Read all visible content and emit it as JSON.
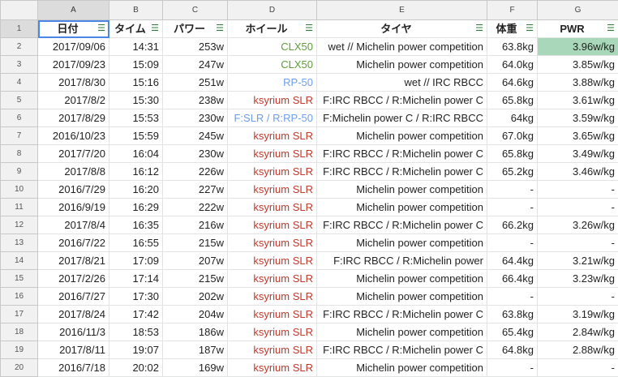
{
  "columns": [
    "A",
    "B",
    "C",
    "D",
    "E",
    "F",
    "G"
  ],
  "header": [
    "日付",
    "タイム",
    "パワー",
    "ホイール",
    "タイヤ",
    "体重",
    "PWR"
  ],
  "rows": [
    {
      "n": "2",
      "date": "2017/09/06",
      "time": "14:31",
      "power": "253w",
      "wheel": "CLX50",
      "wheel_color": "green",
      "tire": "wet // Michelin power competition",
      "weight": "63.8kg",
      "pwr": "3.96w/kg",
      "hl": true
    },
    {
      "n": "3",
      "date": "2017/09/23",
      "time": "15:09",
      "power": "247w",
      "wheel": "CLX50",
      "wheel_color": "green",
      "tire": "Michelin power competition",
      "weight": "64.0kg",
      "pwr": "3.85w/kg"
    },
    {
      "n": "4",
      "date": "2017/8/30",
      "time": "15:16",
      "power": "251w",
      "wheel": "RP-50",
      "wheel_color": "blue",
      "tire": "wet // IRC RBCC",
      "weight": "64.6kg",
      "pwr": "3.88w/kg"
    },
    {
      "n": "5",
      "date": "2017/8/2",
      "time": "15:30",
      "power": "238w",
      "wheel": "ksyrium SLR",
      "wheel_color": "red",
      "tire": "F:IRC RBCC / R:Michelin power C",
      "weight": "65.8kg",
      "pwr": "3.61w/kg"
    },
    {
      "n": "6",
      "date": "2017/8/29",
      "time": "15:53",
      "power": "230w",
      "wheel": "F:SLR / R:RP-50",
      "wheel_color": "blue",
      "tire": "F:Michelin power C / R:IRC RBCC",
      "weight": "64kg",
      "pwr": "3.59w/kg"
    },
    {
      "n": "7",
      "date": "2016/10/23",
      "time": "15:59",
      "power": "245w",
      "wheel": "ksyrium SLR",
      "wheel_color": "red",
      "tire": "Michelin power competition",
      "weight": "67.0kg",
      "pwr": "3.65w/kg"
    },
    {
      "n": "8",
      "date": "2017/7/20",
      "time": "16:04",
      "power": "230w",
      "wheel": "ksyrium SLR",
      "wheel_color": "red",
      "tire": "F:IRC RBCC / R:Michelin power C",
      "weight": "65.8kg",
      "pwr": "3.49w/kg"
    },
    {
      "n": "9",
      "date": "2017/8/8",
      "time": "16:12",
      "power": "226w",
      "wheel": "ksyrium SLR",
      "wheel_color": "red",
      "tire": "F:IRC RBCC / R:Michelin power C",
      "weight": "65.2kg",
      "pwr": "3.46w/kg"
    },
    {
      "n": "10",
      "date": "2016/7/29",
      "time": "16:20",
      "power": "227w",
      "wheel": "ksyrium SLR",
      "wheel_color": "red",
      "tire": "Michelin power competition",
      "weight": "-",
      "pwr": "-"
    },
    {
      "n": "11",
      "date": "2016/9/19",
      "time": "16:29",
      "power": "222w",
      "wheel": "ksyrium SLR",
      "wheel_color": "red",
      "tire": "Michelin power competition",
      "weight": "-",
      "pwr": "-"
    },
    {
      "n": "12",
      "date": "2017/8/4",
      "time": "16:35",
      "power": "216w",
      "wheel": "ksyrium SLR",
      "wheel_color": "red",
      "tire": "F:IRC RBCC / R:Michelin power C",
      "weight": "66.2kg",
      "pwr": "3.26w/kg"
    },
    {
      "n": "13",
      "date": "2016/7/22",
      "time": "16:55",
      "power": "215w",
      "wheel": "ksyrium SLR",
      "wheel_color": "red",
      "tire": "Michelin power competition",
      "weight": "-",
      "pwr": "-"
    },
    {
      "n": "14",
      "date": "2017/8/21",
      "time": "17:09",
      "power": "207w",
      "wheel": "ksyrium SLR",
      "wheel_color": "red",
      "tire": "F:IRC RBCC / R:Michelin power",
      "weight": "64.4kg",
      "pwr": "3.21w/kg"
    },
    {
      "n": "15",
      "date": "2017/2/26",
      "time": "17:14",
      "power": "215w",
      "wheel": "ksyrium SLR",
      "wheel_color": "red",
      "tire": "Michelin power competition",
      "weight": "66.4kg",
      "pwr": "3.23w/kg"
    },
    {
      "n": "16",
      "date": "2016/7/27",
      "time": "17:30",
      "power": "202w",
      "wheel": "ksyrium SLR",
      "wheel_color": "red",
      "tire": "Michelin power competition",
      "weight": "-",
      "pwr": "-"
    },
    {
      "n": "17",
      "date": "2017/8/24",
      "time": "17:42",
      "power": "204w",
      "wheel": "ksyrium SLR",
      "wheel_color": "red",
      "tire": "F:IRC RBCC / R:Michelin power C",
      "weight": "63.8kg",
      "pwr": "3.19w/kg"
    },
    {
      "n": "18",
      "date": "2016/11/3",
      "time": "18:53",
      "power": "186w",
      "wheel": "ksyrium SLR",
      "wheel_color": "red",
      "tire": "Michelin power competition",
      "weight": "65.4kg",
      "pwr": "2.84w/kg"
    },
    {
      "n": "19",
      "date": "2017/8/11",
      "time": "19:07",
      "power": "187w",
      "wheel": "ksyrium SLR",
      "wheel_color": "red",
      "tire": "F:IRC RBCC / R:Michelin power C",
      "weight": "64.8kg",
      "pwr": "2.88w/kg"
    },
    {
      "n": "20",
      "date": "2016/7/18",
      "time": "20:02",
      "power": "169w",
      "wheel": "ksyrium SLR",
      "wheel_color": "red",
      "tire": "Michelin power competition",
      "weight": "-",
      "pwr": "-"
    }
  ]
}
